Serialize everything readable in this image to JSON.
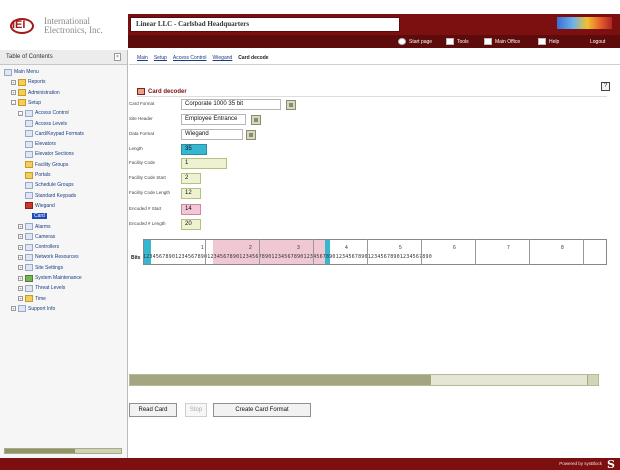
{
  "header": {
    "logo_mark": "IEI",
    "company_line1": "International",
    "company_line2": "Electronics, Inc.",
    "title": "Linear LLC - Carlsbad Headquarters"
  },
  "nav": {
    "items": [
      {
        "label": "Start page",
        "icon": "home-icon"
      },
      {
        "label": "Tools",
        "icon": "tools-icon"
      },
      {
        "label": "Main Office",
        "icon": "monitor-icon"
      },
      {
        "label": "Help",
        "icon": "help-icon"
      },
      {
        "label": "Logout",
        "icon": "logout-icon"
      }
    ]
  },
  "sidebar": {
    "title": "Table of Contents",
    "close_glyph": "×",
    "tree": [
      {
        "label": "Main Menu",
        "level": 0,
        "exp": "",
        "icon": "home"
      },
      {
        "label": "Reports",
        "level": 1,
        "exp": "+",
        "icon": "folder"
      },
      {
        "label": "Administration",
        "level": 1,
        "exp": "+",
        "icon": "folder"
      },
      {
        "label": "Setup",
        "level": 1,
        "exp": "-",
        "icon": "folder"
      },
      {
        "label": "Access Control",
        "level": 2,
        "exp": "-",
        "icon": "doc"
      },
      {
        "label": "Access Levels",
        "level": 3,
        "exp": "",
        "icon": "doc"
      },
      {
        "label": "Card/Keypad Formats",
        "level": 3,
        "exp": "",
        "icon": "doc"
      },
      {
        "label": "Elevators",
        "level": 3,
        "exp": "",
        "icon": "doc"
      },
      {
        "label": "Elevator Sections",
        "level": 3,
        "exp": "",
        "icon": "doc"
      },
      {
        "label": "Facility Groups",
        "level": 3,
        "exp": "",
        "icon": "folder"
      },
      {
        "label": "Portals",
        "level": 3,
        "exp": "",
        "icon": "folder"
      },
      {
        "label": "Schedule Groups",
        "level": 3,
        "exp": "",
        "icon": "doc"
      },
      {
        "label": "Standard Keypads",
        "level": 3,
        "exp": "",
        "icon": "doc"
      },
      {
        "label": "Wiegand",
        "level": 3,
        "exp": "",
        "icon": "red"
      },
      {
        "label": "Card",
        "level": 4,
        "exp": "",
        "icon": "none",
        "selected": true
      },
      {
        "label": "Alarms",
        "level": 2,
        "exp": "+",
        "icon": "doc"
      },
      {
        "label": "Cameras",
        "level": 2,
        "exp": "+",
        "icon": "doc"
      },
      {
        "label": "Controllers",
        "level": 2,
        "exp": "+",
        "icon": "doc"
      },
      {
        "label": "Network Resources",
        "level": 2,
        "exp": "+",
        "icon": "doc"
      },
      {
        "label": "Site Settings",
        "level": 2,
        "exp": "+",
        "icon": "doc"
      },
      {
        "label": "System Maintenance",
        "level": 2,
        "exp": "+",
        "icon": "green"
      },
      {
        "label": "Threat Levels",
        "level": 2,
        "exp": "+",
        "icon": "doc"
      },
      {
        "label": "Time",
        "level": 2,
        "exp": "+",
        "icon": "folder"
      },
      {
        "label": "Support Info",
        "level": 1,
        "exp": "+",
        "icon": "doc"
      }
    ]
  },
  "breadcrumb": {
    "items": [
      "Main",
      "Setup",
      "Access Control",
      "Wiegand"
    ],
    "current": "Card decode"
  },
  "section": {
    "title": "Card decoder",
    "help_glyph": "?"
  },
  "form": {
    "card_format": {
      "label": "Card Format",
      "value": "Corporate 1000 35 bit"
    },
    "site_header": {
      "label": "Site Header",
      "value": "Employee Entrance"
    },
    "data_format": {
      "label": "Data Format",
      "value": "Wiegand"
    },
    "length": {
      "label": "Length",
      "value": "35"
    },
    "facility_code": {
      "label": "Facility Code",
      "value": "1"
    },
    "facility_code_start": {
      "label": "Facility Code Start",
      "value": "2"
    },
    "facility_code_length": {
      "label": "Facility Code Length",
      "value": "12"
    },
    "encoded_id_start": {
      "label": "Encoded # Start",
      "value": "14"
    },
    "encoded_id_length": {
      "label": "Encoded # Length",
      "value": "20"
    }
  },
  "bits": {
    "label": "Bits",
    "digits": "123456789012345678901234567890123456789012345678901234567890123456789012345678901234567890",
    "decades": [
      "1",
      "2",
      "3",
      "4",
      "5",
      "6",
      "7",
      "8"
    ],
    "colors": {
      "parity": "#36b6cf",
      "facility": "#f0c8d4",
      "encoded": "#e9edc8"
    }
  },
  "scroll": {
    "position_fraction": 0.66
  },
  "buttons": {
    "read_card": "Read Card",
    "stop": "Stop",
    "create_card_format": "Create Card Format"
  },
  "footer": {
    "powered": "Powered by sysBlock",
    "mark": "S"
  },
  "colors": {
    "brand_dark": "#7c1010",
    "nav_dark": "#5e0b0b",
    "link": "#1b3b84"
  }
}
